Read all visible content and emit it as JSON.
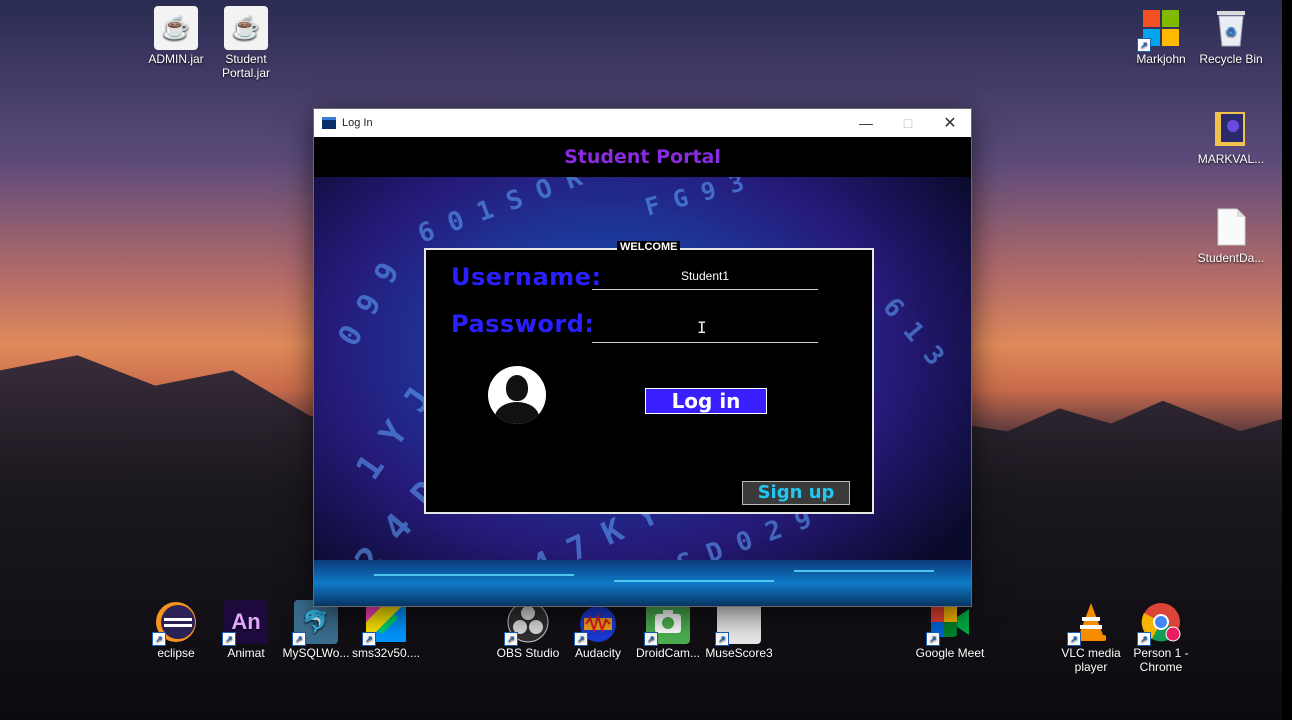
{
  "desktop": {
    "top_left_icons": [
      {
        "label": "ADMIN.jar"
      },
      {
        "label": "Student Portal.jar"
      }
    ],
    "top_right_icons": [
      {
        "label": "Markjohn"
      },
      {
        "label": "Recycle Bin"
      },
      {
        "label": "MARKVAL..."
      },
      {
        "label": "StudentDa..."
      }
    ],
    "bottom_icons": [
      {
        "label": "eclipse"
      },
      {
        "label": "Animat"
      },
      {
        "label": "MySQLWo..."
      },
      {
        "label": "sms32v50...."
      },
      {
        "label": "OBS Studio"
      },
      {
        "label": "Audacity"
      },
      {
        "label": "DroidCam..."
      },
      {
        "label": "MuseScore3"
      },
      {
        "label": "Google Meet"
      },
      {
        "label": "VLC media player"
      },
      {
        "label": "Person 1 - Chrome"
      }
    ]
  },
  "window": {
    "title": "Log In",
    "controls": {
      "minimize": "—",
      "maximize": "□",
      "close": "✕"
    },
    "header_title": "Student Portal",
    "panel": {
      "legend": "WELCOME",
      "username_label": "Username:",
      "username_value": "Student1",
      "password_label": "Password:",
      "password_value": "",
      "login_button": "Log in",
      "signup_button": "Sign up"
    }
  }
}
